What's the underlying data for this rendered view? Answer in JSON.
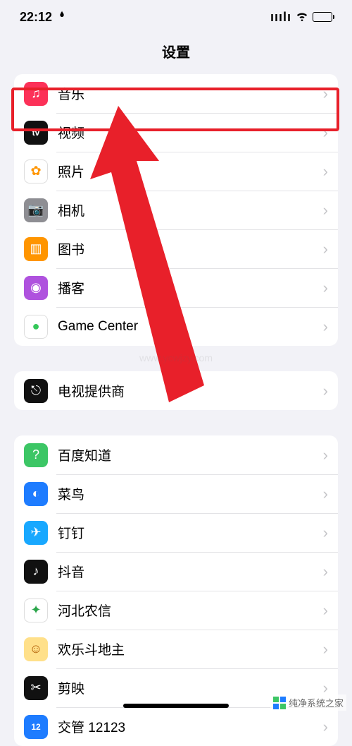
{
  "status": {
    "time": "22:12",
    "flame": "ⓘ",
    "signal": "ııılı",
    "wifi": "",
    "battery_pct": 100
  },
  "header": {
    "title": "设置"
  },
  "groups": [
    {
      "rows": [
        {
          "id": "music",
          "label": "音乐",
          "icon_name": "music-icon",
          "bg": "#fc3158",
          "glyph": "♫"
        },
        {
          "id": "tv",
          "label": "视频",
          "icon_name": "appletv-icon",
          "bg": "#111111",
          "glyph": "tv",
          "glyph_small": true
        },
        {
          "id": "photos",
          "label": "照片",
          "icon_name": "photos-icon",
          "bg": "#ffffff",
          "glyph": "✿",
          "fg": "#ff9500"
        },
        {
          "id": "camera",
          "label": "相机",
          "icon_name": "camera-icon",
          "bg": "#8e8e93",
          "glyph": "📷"
        },
        {
          "id": "books",
          "label": "图书",
          "icon_name": "books-icon",
          "bg": "#ff9500",
          "glyph": "▥"
        },
        {
          "id": "podcasts",
          "label": "播客",
          "icon_name": "podcasts-icon",
          "bg": "#af52de",
          "glyph": "◉"
        },
        {
          "id": "gamecenter",
          "label": "Game Center",
          "icon_name": "gamecenter-icon",
          "bg": "#ffffff",
          "glyph": "●",
          "fg": "#34c759"
        }
      ]
    },
    {
      "rows": [
        {
          "id": "tvprovider",
          "label": "电视提供商",
          "icon_name": "tvprovider-icon",
          "bg": "#111111",
          "glyph": "⎋"
        }
      ]
    },
    {
      "rows": [
        {
          "id": "baiduzhdao",
          "label": "百度知道",
          "icon_name": "baidu-icon",
          "bg": "#3cc665",
          "glyph": "?"
        },
        {
          "id": "cainiao",
          "label": "菜鸟",
          "icon_name": "cainiao-icon",
          "bg": "#1e7cff",
          "glyph": "◐"
        },
        {
          "id": "dingtalk",
          "label": "钉钉",
          "icon_name": "dingtalk-icon",
          "bg": "#18a8ff",
          "glyph": "✈"
        },
        {
          "id": "douyin",
          "label": "抖音",
          "icon_name": "douyin-icon",
          "bg": "#111111",
          "glyph": "♪"
        },
        {
          "id": "hbnx",
          "label": "河北农信",
          "icon_name": "hbnx-icon",
          "bg": "#ffffff",
          "glyph": "✦",
          "fg": "#2aa54a"
        },
        {
          "id": "hlddz",
          "label": "欢乐斗地主",
          "icon_name": "hlddz-icon",
          "bg": "#ffe08a",
          "glyph": "☺",
          "fg": "#b05a00"
        },
        {
          "id": "jianying",
          "label": "剪映",
          "icon_name": "jianying-icon",
          "bg": "#111111",
          "glyph": "✂"
        },
        {
          "id": "jiaoguan",
          "label": "交管 12123",
          "icon_name": "jiaoguan-icon",
          "bg": "#1e7cff",
          "glyph": "12",
          "glyph_small": true
        }
      ]
    }
  ],
  "annotation": {
    "highlight_row": "music",
    "arrow_color": "#e8202a"
  },
  "watermarks": {
    "mid": "www.ycwjzy.com",
    "bottom": "纯净系统之家"
  }
}
